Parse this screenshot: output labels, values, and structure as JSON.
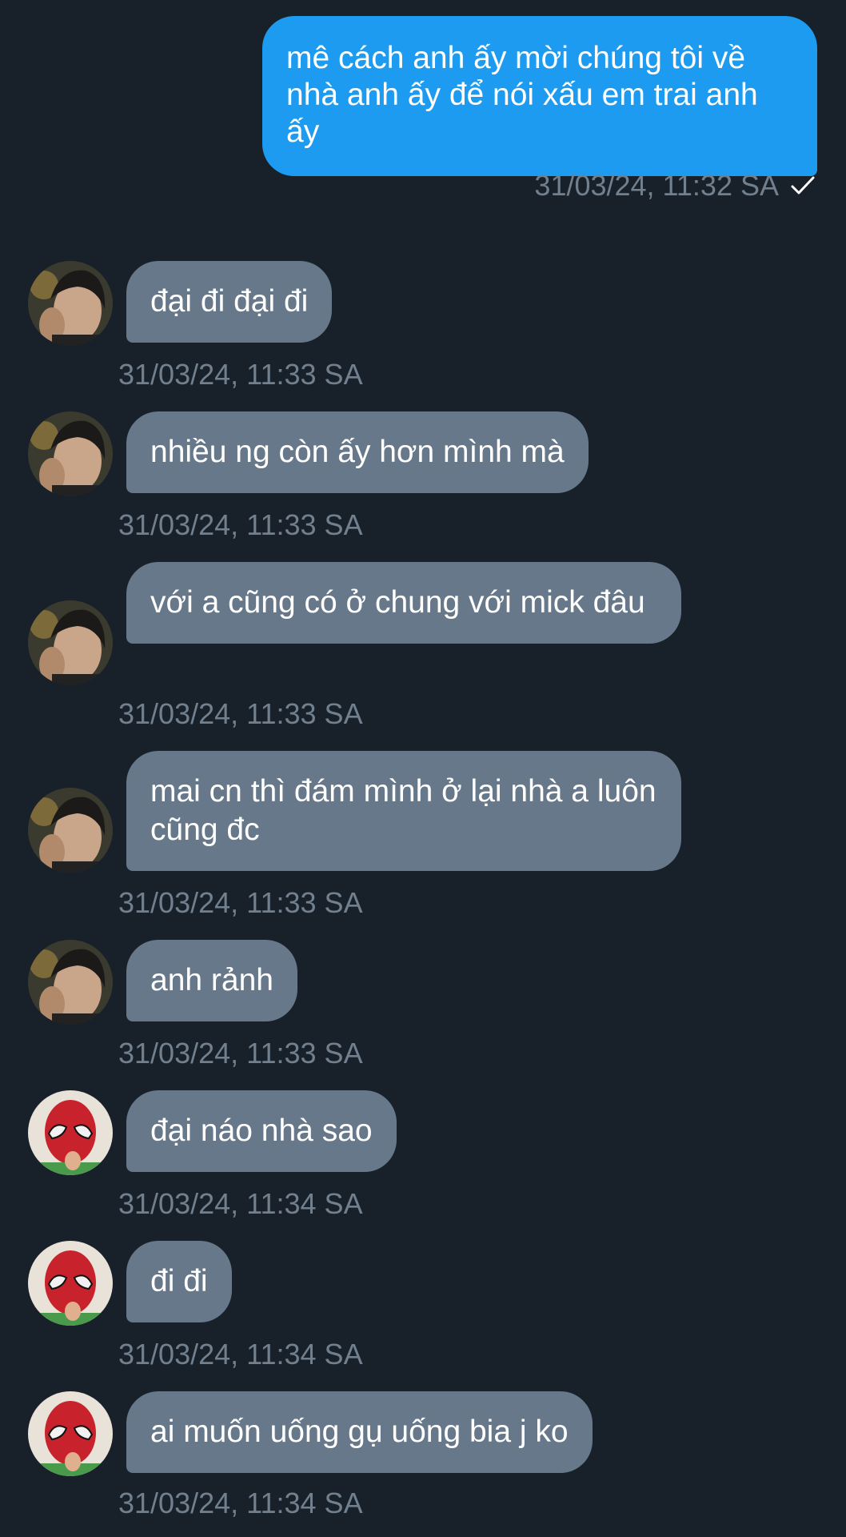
{
  "outgoing": {
    "text": "mê cách anh ấy mời chúng tôi về nhà anh ấy để nói xấu em trai anh ấy",
    "time": "31/03/24, 11:32 SA",
    "status_icon": "check-icon"
  },
  "incoming": [
    {
      "text": "đại đi đại đi",
      "time": "31/03/24, 11:33 SA",
      "avatar": "avatar-dark-hair"
    },
    {
      "text": "nhiều ng còn ấy hơn mình mà",
      "time": "31/03/24, 11:33 SA",
      "avatar": "avatar-dark-hair"
    },
    {
      "text": "với a cũng có ở chung với mick đâu",
      "time": "31/03/24, 11:33 SA",
      "avatar": "avatar-dark-hair"
    },
    {
      "text": "mai cn thì đám mình ở lại nhà a luôn cũng đc",
      "time": "31/03/24, 11:33 SA",
      "avatar": "avatar-dark-hair"
    },
    {
      "text": "anh rảnh",
      "time": "31/03/24, 11:33 SA",
      "avatar": "avatar-dark-hair"
    },
    {
      "text": "đại náo nhà sao",
      "time": "31/03/24, 11:34 SA",
      "avatar": "avatar-spider-mask"
    },
    {
      "text": "đi đi",
      "time": "31/03/24, 11:34 SA",
      "avatar": "avatar-spider-mask"
    },
    {
      "text": "ai muốn uống gụ uống bia j ko",
      "time": "31/03/24, 11:34 SA",
      "avatar": "avatar-spider-mask"
    }
  ],
  "colors": {
    "background": "#18202a",
    "outgoing_bubble": "#1d9bf0",
    "incoming_bubble": "#66788a",
    "timestamp": "#71808e"
  }
}
